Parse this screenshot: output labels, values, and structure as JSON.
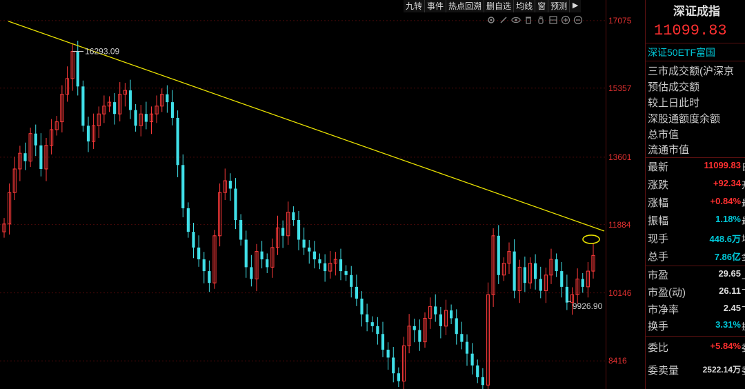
{
  "toolbar": {
    "buttons": [
      "九转",
      "事件",
      "热点回溯",
      "删自选",
      "均线",
      "窗",
      "预测"
    ],
    "arrow": "▶"
  },
  "tools": [
    "settings-icon",
    "draw-icon",
    "eye-icon",
    "trash-icon",
    "hand-icon",
    "layers-icon",
    "zoom-in-icon",
    "zoom-out-icon"
  ],
  "chart_data": {
    "type": "candlestick",
    "y_axis_ticks": [
      17075,
      15357,
      13601,
      11884,
      10146,
      8416
    ],
    "ylim": [
      7700,
      17600
    ],
    "annotations": {
      "high": "16293.09",
      "low": "9926.90"
    },
    "trendline": {
      "color": "#e8e000",
      "from": 17060,
      "to": 11720
    },
    "series": [
      {
        "name": "closes",
        "values": [
          11900,
          12700,
          13300,
          13700,
          13500,
          14200,
          13900,
          13300,
          13900,
          14300,
          14500,
          15200,
          15600,
          16293,
          15400,
          14400,
          14000,
          14400,
          14700,
          14900,
          15000,
          14700,
          15200,
          15300,
          14800,
          14400,
          14700,
          14500,
          14700,
          14900,
          15200,
          15000,
          14600,
          13400,
          12300,
          11700,
          11300,
          11000,
          10700,
          10400,
          11600,
          12700,
          13000,
          12800,
          12000,
          11500,
          10800,
          10500,
          11200,
          11000,
          10800,
          11300,
          11800,
          11600,
          12200,
          12000,
          11500,
          11300,
          11200,
          11000,
          10900,
          10700,
          10900,
          11000,
          10700,
          10600,
          10300,
          10000,
          9600,
          9400,
          9300,
          9100,
          8700,
          8500,
          8100,
          7900,
          8800,
          9300,
          9200,
          8900,
          9500,
          9800,
          9600,
          9300,
          9700,
          9500,
          9100,
          8900,
          8600,
          8300,
          8000,
          7800,
          10100,
          11600,
          10600,
          10900,
          11200,
          10200,
          10800,
          10400,
          10900,
          10500,
          10200,
          10600,
          11000,
          10700,
          10300,
          9900,
          10100,
          10500,
          10300,
          10700,
          11099.83
        ]
      }
    ]
  },
  "panel": {
    "title": "深证成指",
    "price": "11099.83",
    "etf": "深证50ETF富国",
    "info_lines": [
      "三市成交额(沪深京",
      "预估成交额",
      "较上日此时",
      "深股通额度余额",
      "总市值",
      "流通市值"
    ],
    "rows": [
      {
        "label": "最新",
        "value": "11099.83",
        "suffix": "日",
        "color": "red"
      },
      {
        "label": "涨跌",
        "value": "+92.34",
        "suffix": "开",
        "color": "red"
      },
      {
        "label": "涨幅",
        "value": "+0.84%",
        "suffix": "最",
        "color": "red"
      },
      {
        "label": "振幅",
        "value": "1.18%",
        "suffix": "最",
        "color": "cyan"
      },
      {
        "label": "现手",
        "value": "448.6万",
        "suffix": "均",
        "color": "cyan"
      },
      {
        "label": "总手",
        "value": "7.86亿",
        "suffix": "金",
        "color": "cyan"
      },
      {
        "label": "市盈",
        "value": "29.65",
        "suffix": "上",
        "color": "white"
      },
      {
        "label": "市盈(动)",
        "value": "26.11",
        "suffix": "下",
        "color": "white"
      },
      {
        "label": "市净率",
        "value": "2.45",
        "suffix": "下",
        "color": "white"
      },
      {
        "label": "换手",
        "value": "3.31%",
        "suffix": "换",
        "color": "cyan"
      },
      {
        "label": "委比",
        "value": "+5.84%",
        "suffix": "委",
        "color": "red"
      },
      {
        "label": "委卖量",
        "value": "2522.14万",
        "suffix": "委",
        "color": "white"
      }
    ]
  }
}
